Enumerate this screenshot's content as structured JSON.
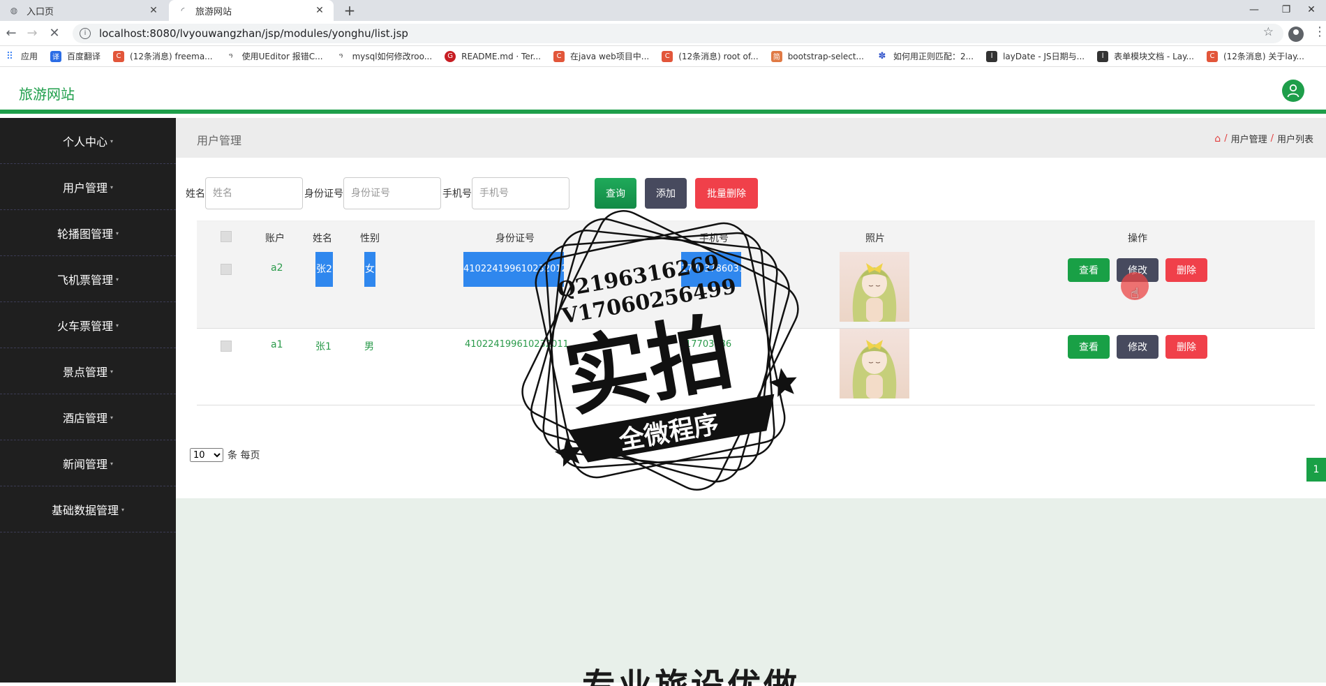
{
  "browser": {
    "tabs": [
      {
        "title": "入口页",
        "active": false
      },
      {
        "title": "旅游网站",
        "active": true
      }
    ],
    "url": "localhost:8080/lvyouwangzhan/jsp/modules/yonghu/list.jsp",
    "bookmarks": [
      {
        "label": "应用",
        "icon": "apps-icon",
        "color": "#4285f4"
      },
      {
        "label": "百度翻译",
        "icon": "baidu-translate-icon",
        "color": "#2b6de5"
      },
      {
        "label": "(12条消息) freema...",
        "icon": "csdn-icon",
        "color": "#e2563a"
      },
      {
        "label": "使用UEditor 报错C...",
        "icon": "mushroom-icon",
        "color": "#555555"
      },
      {
        "label": "mysql如何修改roo...",
        "icon": "mushroom-icon",
        "color": "#555555"
      },
      {
        "label": "README.md · Ter...",
        "icon": "gitee-icon",
        "color": "#c71d23"
      },
      {
        "label": "在java web项目中...",
        "icon": "csdn-icon",
        "color": "#e2563a"
      },
      {
        "label": "(12条消息) root of...",
        "icon": "csdn-icon",
        "color": "#e2563a"
      },
      {
        "label": "bootstrap-select...",
        "icon": "jian-icon",
        "color": "#e07a45"
      },
      {
        "label": "如何用正则匹配：2...",
        "icon": "paw-icon",
        "color": "#3355cc"
      },
      {
        "label": "layDate - JS日期与...",
        "icon": "layui-icon",
        "color": "#333333"
      },
      {
        "label": "表单模块文档 - Lay...",
        "icon": "layui-icon",
        "color": "#333333"
      },
      {
        "label": "(12条消息) 关于lay...",
        "icon": "csdn-icon",
        "color": "#e2563a"
      }
    ]
  },
  "app": {
    "brand": "旅游网站",
    "accent": "#1e9e4a",
    "sidebar": [
      "个人中心",
      "用户管理",
      "轮播图管理",
      "飞机票管理",
      "火车票管理",
      "景点管理",
      "酒店管理",
      "新闻管理",
      "基础数据管理"
    ],
    "page_title": "用户管理",
    "breadcrumb": [
      "用户管理",
      "用户列表"
    ],
    "search": {
      "name_label": "姓名",
      "name_placeholder": "姓名",
      "id_label": "身份证号",
      "id_placeholder": "身份证号",
      "phone_label": "手机号",
      "phone_placeholder": "手机号",
      "query": "查询",
      "add": "添加",
      "batch_delete": "批量删除"
    },
    "table": {
      "headers": [
        "账户",
        "姓名",
        "性别",
        "身份证号",
        "手机号",
        "照片",
        "操作"
      ],
      "rows": [
        {
          "account": "a2",
          "name": "张2",
          "gender": "女",
          "id_number": "410224199610232012",
          "phone": "17703786031"
        },
        {
          "account": "a1",
          "name": "张1",
          "gender": "男",
          "id_number": "410224199610232011",
          "phone": "17703786"
        }
      ],
      "actions": {
        "view": "查看",
        "edit": "修改",
        "delete": "删除"
      }
    },
    "pager": {
      "page_size": "10",
      "page_size_suffix": "条 每页",
      "current_page": "1"
    },
    "bottom_text": "专业旅设优做"
  },
  "watermark": {
    "contact_line1": "Q2196316269",
    "contact_line2": "V17060256499",
    "big_text": "实拍",
    "banner_text": "全微程序"
  }
}
